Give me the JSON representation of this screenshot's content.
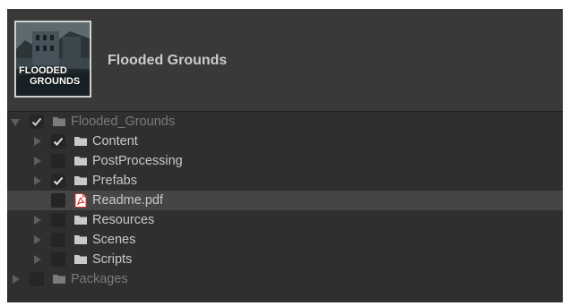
{
  "package": {
    "title": "Flooded Grounds",
    "thumbnail_text_line1": "FLOODED",
    "thumbnail_text_line2": "GROUNDS"
  },
  "tree": [
    {
      "label": "Flooded_Grounds",
      "icon": "folder-icon",
      "checked": true,
      "arrow": "expanded",
      "dim": true,
      "selected": false
    },
    {
      "label": "Content",
      "icon": "folder-icon",
      "checked": true,
      "arrow": "collapsed",
      "dim": false,
      "selected": false
    },
    {
      "label": "PostProcessing",
      "icon": "folder-icon",
      "checked": false,
      "arrow": "collapsed",
      "dim": false,
      "selected": false
    },
    {
      "label": "Prefabs",
      "icon": "folder-icon",
      "checked": true,
      "arrow": "collapsed",
      "dim": false,
      "selected": false
    },
    {
      "label": "Readme.pdf",
      "icon": "pdf-file-icon",
      "checked": false,
      "arrow": "none",
      "dim": false,
      "selected": true
    },
    {
      "label": "Resources",
      "icon": "folder-icon",
      "checked": false,
      "arrow": "collapsed",
      "dim": false,
      "selected": false
    },
    {
      "label": "Scenes",
      "icon": "folder-icon",
      "checked": false,
      "arrow": "collapsed",
      "dim": false,
      "selected": false
    },
    {
      "label": "Scripts",
      "icon": "folder-icon",
      "checked": false,
      "arrow": "collapsed",
      "dim": false,
      "selected": false
    },
    {
      "label": "Packages",
      "icon": "folder-icon",
      "checked": false,
      "arrow": "collapsed",
      "dim": true,
      "selected": false
    }
  ],
  "colors": {
    "background": "#2f2f2f",
    "header": "#393939",
    "selected_row": "#454545",
    "text": "#c8c8c8",
    "dim_text": "#7b7b7b",
    "pdf_red": "#d63a32"
  }
}
